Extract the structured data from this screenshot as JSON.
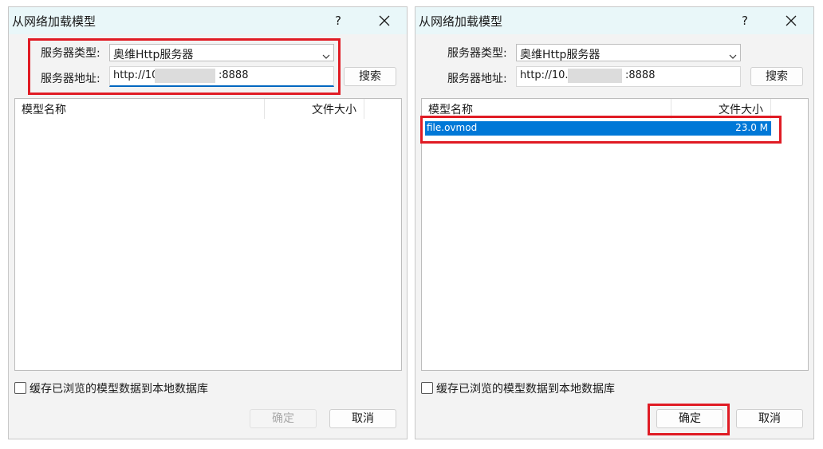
{
  "left_dialog": {
    "title": "从网络加载模型",
    "help": "?",
    "server_type_label": "服务器类型:",
    "server_type_value": "奥维Http服务器",
    "server_addr_label": "服务器地址:",
    "server_addr_prefix": "http://10.",
    "server_addr_port": ":8888",
    "search_button": "搜索",
    "columns": {
      "name": "模型名称",
      "size": "文件大小"
    },
    "cache_checkbox_label": "缓存已浏览的模型数据到本地数据库",
    "cache_checked": false,
    "ok_button": "确定",
    "cancel_button": "取消"
  },
  "right_dialog": {
    "title": "从网络加载模型",
    "help": "?",
    "server_type_label": "服务器类型:",
    "server_type_value": "奥维Http服务器",
    "server_addr_label": "服务器地址:",
    "server_addr_prefix": "http://10.:",
    "server_addr_port": ":8888",
    "search_button": "搜索",
    "columns": {
      "name": "模型名称",
      "size": "文件大小"
    },
    "rows": [
      {
        "name": "file.ovmod",
        "size": "23.0 M",
        "selected": true
      }
    ],
    "cache_checkbox_label": "缓存已浏览的模型数据到本地数据库",
    "cache_checked": false,
    "ok_button": "确定",
    "cancel_button": "取消"
  },
  "colors": {
    "highlight": "#e01b24",
    "selection": "#0078d7",
    "titlebar": "#e9f7f9"
  }
}
